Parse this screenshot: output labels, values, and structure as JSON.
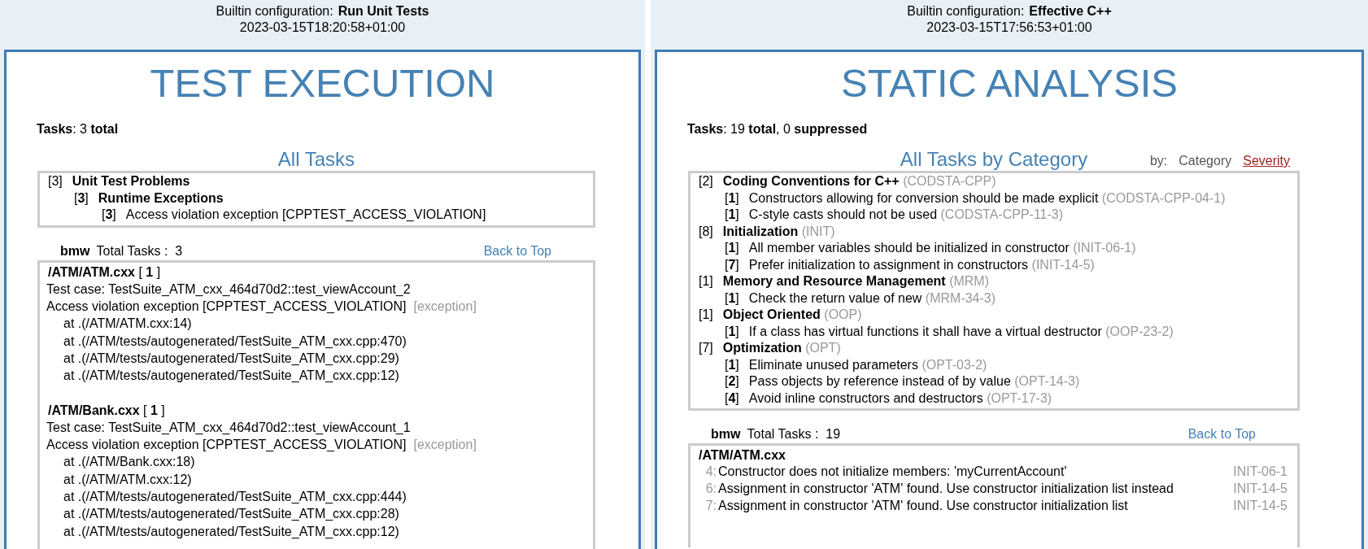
{
  "panels": [
    {
      "kind": "tests",
      "config_label": "Builtin configuration:",
      "config_name": "Run Unit Tests",
      "timestamp": "2023-03-15T18:20:58+01:00",
      "title": "TEST EXECUTION",
      "tasks_summary": "**Tasks**: 3 **total**",
      "all_tasks": {
        "heading": "All Tasks",
        "tree": [
          {
            "count": "[3]",
            "label": "Unit Test Problems",
            "children": [
              {
                "count": "[**3**]",
                "label": "Runtime Exceptions",
                "children": [
                  {
                    "count": "[**3**]",
                    "label": "Access violation exception [CPPTEST_ACCESS_VIOLATION]"
                  }
                ]
              }
            ]
          }
        ]
      },
      "group": {
        "name": "bmw",
        "total_label": "Total Tasks :",
        "total": "3",
        "back_link": "Back to Top"
      },
      "files": [
        {
          "path": "**/ATM/ATM.cxx** [ **1** ]",
          "test_case": "Test case: TestSuite_ATM_cxx_464d70d2::test_viewAccount_2",
          "message": "Access violation exception [CPPTEST_ACCESS_VIOLATION]",
          "tag": "[exception]",
          "stack": [
            "at .(/ATM/ATM.cxx:14)",
            "at .(/ATM/tests/autogenerated/TestSuite_ATM_cxx.cpp:470)",
            "at .(/ATM/tests/autogenerated/TestSuite_ATM_cxx.cpp:29)",
            "at .(/ATM/tests/autogenerated/TestSuite_ATM_cxx.cpp:12)"
          ]
        },
        {
          "path": "**/ATM/Bank.cxx** [ **1** ]",
          "test_case": "Test case: TestSuite_ATM_cxx_464d70d2::test_viewAccount_1",
          "message": "Access violation exception [CPPTEST_ACCESS_VIOLATION]",
          "tag": "[exception]",
          "stack": [
            "at .(/ATM/Bank.cxx:18)",
            "at .(/ATM/ATM.cxx:12)",
            "at .(/ATM/tests/autogenerated/TestSuite_ATM_cxx.cpp:444)",
            "at .(/ATM/tests/autogenerated/TestSuite_ATM_cxx.cpp:28)",
            "at .(/ATM/tests/autogenerated/TestSuite_ATM_cxx.cpp:12)"
          ]
        }
      ]
    },
    {
      "kind": "static",
      "config_label": "Builtin configuration:",
      "config_name": "Effective C++",
      "timestamp": "2023-03-15T17:56:53+01:00",
      "title": "STATIC ANALYSIS",
      "tasks_summary": "**Tasks**: 19 **total**,  0 **suppressed**",
      "all_tasks": {
        "heading": "All Tasks by Category",
        "sort_label": "by:",
        "sort_options": [
          {
            "label": "Category",
            "selected": true
          },
          {
            "label": "Severity",
            "selected": false
          }
        ],
        "tree": [
          {
            "count": "[2]",
            "label": "Coding Conventions for C++",
            "code": "(CODSTA-CPP)",
            "children": [
              {
                "count": "[**1**]",
                "label": "Constructors allowing for conversion should be made explicit",
                "code": "(CODSTA-CPP-04-1)"
              },
              {
                "count": "[**1**]",
                "label": "C-style casts should not be used",
                "code": "(CODSTA-CPP-11-3)"
              }
            ]
          },
          {
            "count": "[8]",
            "label": "Initialization",
            "code": "(INIT)",
            "children": [
              {
                "count": "[**1**]",
                "label": "All member variables should be initialized in constructor",
                "code": "(INIT-06-1)"
              },
              {
                "count": "[**7**]",
                "label": "Prefer initialization to assignment in constructors",
                "code": "(INIT-14-5)"
              }
            ]
          },
          {
            "count": "[1]",
            "label": "Memory and Resource Management",
            "code": "(MRM)",
            "children": [
              {
                "count": "[**1**]",
                "label": "Check the return value of new",
                "code": "(MRM-34-3)"
              }
            ]
          },
          {
            "count": "[1]",
            "label": "Object Oriented",
            "code": "(OOP)",
            "children": [
              {
                "count": "[**1**]",
                "label": "If a class has virtual functions it shall have a virtual destructor",
                "code": "(OOP-23-2)"
              }
            ]
          },
          {
            "count": "[7]",
            "label": "Optimization",
            "code": "(OPT)",
            "children": [
              {
                "count": "[**1**]",
                "label": "Eliminate unused parameters",
                "code": "(OPT-03-2)"
              },
              {
                "count": "[**2**]",
                "label": "Pass objects by reference instead of by value",
                "code": "(OPT-14-3)"
              },
              {
                "count": "[**4**]",
                "label": "Avoid inline constructors and destructors",
                "code": "(OPT-17-3)"
              }
            ]
          }
        ]
      },
      "group": {
        "name": "bmw",
        "total_label": "Total Tasks :",
        "total": "19",
        "back_link": "Back to Top"
      },
      "files": [
        {
          "path": "**/ATM/ATM.cxx**",
          "findings": [
            {
              "line": "4:",
              "message": "Constructor does not initialize members: 'myCurrentAccount'",
              "rule": "INIT-06-1"
            },
            {
              "line": "6:",
              "message": "Assignment in constructor 'ATM' found. Use constructor initialization list instead",
              "rule": "INIT-14-5"
            },
            {
              "line": "7:",
              "message": "Assignment in constructor 'ATM' found. Use constructor initialization list",
              "rule": "INIT-14-5"
            }
          ]
        }
      ]
    }
  ]
}
